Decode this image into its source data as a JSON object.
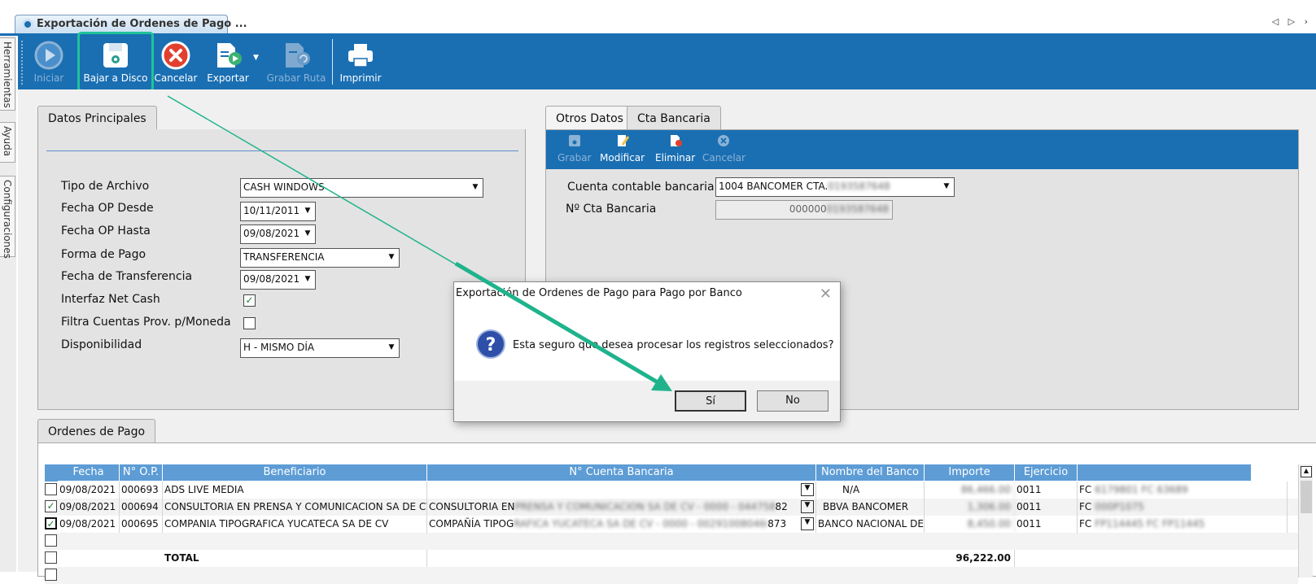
{
  "window": {
    "tab_title": "Exportación de Ordenes de Pago ...",
    "nav_arrows": "◁ ▷ ›"
  },
  "rail": {
    "items": [
      "Herramientas",
      "Ayuda",
      "Configuraciones"
    ]
  },
  "toolbar": {
    "iniciar": "Iniciar",
    "bajar": "Bajar a Disco",
    "cancelar": "Cancelar",
    "exportar": "Exportar",
    "grabar_ruta": "Grabar Ruta",
    "imprimir": "Imprimir"
  },
  "datos": {
    "tab": "Datos Principales",
    "tipo_archivo_label": "Tipo de Archivo",
    "tipo_archivo": "CASH WINDOWS",
    "fecha_desde_label": "Fecha OP Desde",
    "fecha_desde": "10/11/2011",
    "fecha_hasta_label": "Fecha OP Hasta",
    "fecha_hasta": "09/08/2021",
    "forma_pago_label": "Forma de Pago",
    "forma_pago": "TRANSFERENCIA",
    "fecha_transf_label": "Fecha de Transferencia",
    "fecha_transf": "09/08/2021",
    "interfaz_label": "Interfaz Net Cash",
    "filtra_label": "Filtra Cuentas Prov. p/Moneda",
    "disponibilidad_label": "Disponibilidad",
    "disponibilidad": "H - MISMO DÍA"
  },
  "otros": {
    "tab_otros": "Otros Datos",
    "tab_cta": "Cta Bancaria",
    "grabar": "Grabar",
    "modificar": "Modificar",
    "eliminar": "Eliminar",
    "cancelar": "Cancelar",
    "cuenta_label": "Cuenta contable bancaria",
    "cuenta_value": "1004  BANCOMER CTA.",
    "cuenta_hidden": "0193587648",
    "nro_label": "Nº Cta Bancaria",
    "nro_value": "000000",
    "nro_hidden": "0193587648"
  },
  "ordenes": {
    "tab": "Ordenes de Pago",
    "headers": [
      "Fecha",
      "N° O.P.",
      "Beneficiario",
      "N° Cuenta Bancaria",
      "Nombre del Banco",
      "Importe",
      "Ejercicio",
      ""
    ],
    "rows": [
      {
        "checked": "",
        "fecha": "09/08/2021",
        "op": "000693",
        "benef": "ADS LIVE MEDIA",
        "cuenta": "",
        "cuenta_blur": "",
        "cuenta_end": "",
        "banco": "N/A",
        "importe": "86,466.00",
        "ejercicio": "0011",
        "ref": "FC",
        "ref_blur": "6179801 FC 63689"
      },
      {
        "checked": "✓",
        "fecha": "09/08/2021",
        "op": "000694",
        "benef": "CONSULTORIA EN PRENSA Y COMUNICACION SA DE CV",
        "cuenta": "CONSULTORIA EN",
        "cuenta_blur": "PRENSA Y COMUNICACION SA DE CV - 0000 - 044758453",
        "cuenta_end": "82",
        "banco": "BBVA BANCOMER",
        "importe": "1,306.00",
        "ejercicio": "0011",
        "ref": "FC",
        "ref_blur": "000P1075"
      },
      {
        "checked": "✓",
        "fecha": "09/08/2021",
        "op": "000695",
        "benef": "COMPANIA TIPOGRAFICA YUCATECA SA DE CV",
        "cuenta": "COMPAÑÍA TIPOG",
        "cuenta_blur": "RAFICA YUCATECA SA DE CV - 0000 - 002910080468",
        "cuenta_end": "873",
        "banco": "BANCO NACIONAL DE",
        "importe": "8,450.00",
        "ejercicio": "0011",
        "ref": "FC",
        "ref_blur": "FP114445 FC FP11445"
      }
    ],
    "total_label": "TOTAL",
    "total_value": "96,222.00"
  },
  "dialog": {
    "title": "Exportación de Ordenes de Pago para Pago por Banco",
    "message": "Esta seguro que desea procesar los registros seleccionados?",
    "yes": "Sí",
    "no": "No",
    "close": "✕"
  },
  "colors": {
    "accent": "#1a6fb3",
    "highlight": "#1fc39a",
    "grid_header": "#5d9cd5"
  }
}
